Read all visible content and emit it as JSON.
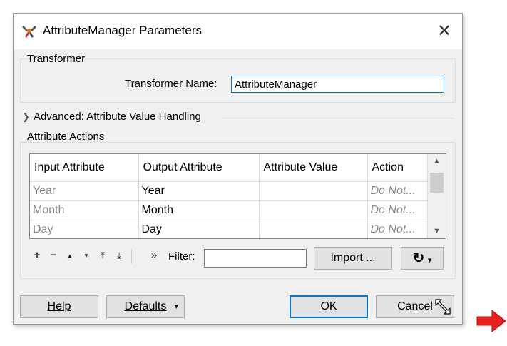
{
  "window": {
    "title": "AttributeManager Parameters",
    "close_glyph": "✕"
  },
  "transformer": {
    "group_label": "Transformer",
    "name_label": "Transformer Name:",
    "name_value": "AttributeManager"
  },
  "advanced": {
    "label": "Advanced: Attribute Value Handling",
    "chevron_icon": "chevron-right-icon"
  },
  "attribute_actions": {
    "group_label": "Attribute Actions",
    "columns": [
      "Input Attribute",
      "Output Attribute",
      "Attribute Value",
      "Action"
    ],
    "rows": [
      {
        "input": "Year",
        "output": "Year",
        "value": "",
        "action": "Do Not..."
      },
      {
        "input": "Month",
        "output": "Month",
        "value": "",
        "action": "Do Not..."
      },
      {
        "input": "Day",
        "output": "Day",
        "value": "",
        "action": "Do Not..."
      }
    ]
  },
  "toolbar": {
    "add_glyph": "+",
    "remove_glyph": "−",
    "move_up_glyph": "▲",
    "move_down_glyph": "▼",
    "move_top_glyph": "⤒",
    "move_bottom_glyph": "⤓",
    "more_glyph": "»",
    "filter_label": "Filter:",
    "filter_value": "",
    "import_label": "Import ...",
    "refresh_glyph": "↻",
    "dropdown_glyph": "▾"
  },
  "footer": {
    "help_label": "Help",
    "defaults_label": "Defaults",
    "defaults_arrow": "▾",
    "ok_label": "OK",
    "cancel_label": "Cancel"
  },
  "colors": {
    "dialog_bg": "#f0f0f0",
    "focus_blue": "#0078d7",
    "annotation_red": "#e8201c"
  }
}
